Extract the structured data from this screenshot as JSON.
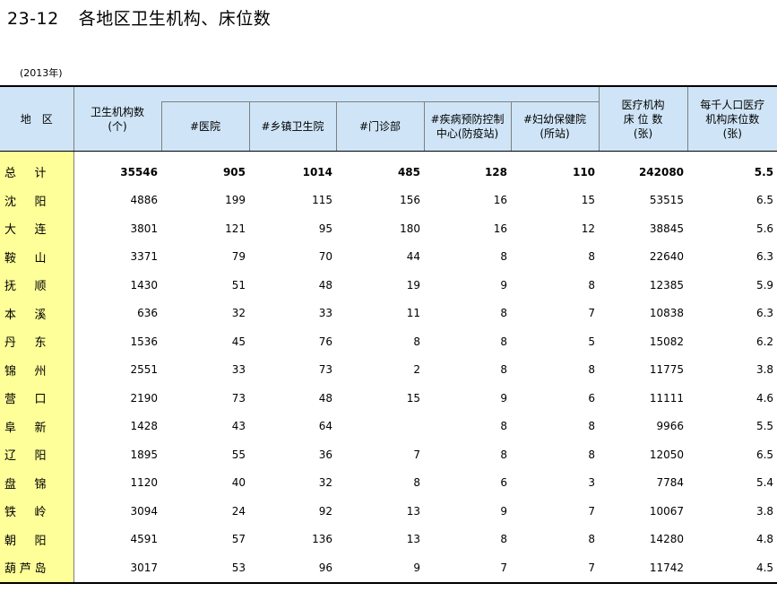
{
  "title": {
    "number": "23-12",
    "text": "各地区卫生机构、床位数"
  },
  "year_note": "(2013年)",
  "table": {
    "header_region": "地　区",
    "header_institutions": "卫生机构数",
    "header_institutions_unit": "(个)",
    "header_hospitals": "#医院",
    "header_township": "#乡镇卫生院",
    "header_clinics": "#门诊部",
    "header_cdc_line1": "#疾病预防控制",
    "header_cdc_line2": "中心(防疫站)",
    "header_mch_line1": "#妇幼保健院",
    "header_mch_line2": "(所站)",
    "header_beds_line1": "医疗机构",
    "header_beds_line2": "床 位 数",
    "header_beds_line3": "(张)",
    "header_per1000_line1": "每千人口医疗",
    "header_per1000_line2": "机构床位数",
    "header_per1000_line3": "(张)",
    "rows": [
      {
        "region": "总计",
        "inst": "35546",
        "hosp": "905",
        "town": "1014",
        "clinic": "485",
        "cdc": "128",
        "mch": "110",
        "beds": "242080",
        "per1000": "5.5"
      },
      {
        "region": "沈阳",
        "inst": "4886",
        "hosp": "199",
        "town": "115",
        "clinic": "156",
        "cdc": "16",
        "mch": "15",
        "beds": "53515",
        "per1000": "6.5"
      },
      {
        "region": "大连",
        "inst": "3801",
        "hosp": "121",
        "town": "95",
        "clinic": "180",
        "cdc": "16",
        "mch": "12",
        "beds": "38845",
        "per1000": "5.6"
      },
      {
        "region": "鞍山",
        "inst": "3371",
        "hosp": "79",
        "town": "70",
        "clinic": "44",
        "cdc": "8",
        "mch": "8",
        "beds": "22640",
        "per1000": "6.3"
      },
      {
        "region": "抚顺",
        "inst": "1430",
        "hosp": "51",
        "town": "48",
        "clinic": "19",
        "cdc": "9",
        "mch": "8",
        "beds": "12385",
        "per1000": "5.9"
      },
      {
        "region": "本溪",
        "inst": "636",
        "hosp": "32",
        "town": "33",
        "clinic": "11",
        "cdc": "8",
        "mch": "7",
        "beds": "10838",
        "per1000": "6.3"
      },
      {
        "region": "丹东",
        "inst": "1536",
        "hosp": "45",
        "town": "76",
        "clinic": "8",
        "cdc": "8",
        "mch": "5",
        "beds": "15082",
        "per1000": "6.2"
      },
      {
        "region": "锦州",
        "inst": "2551",
        "hosp": "33",
        "town": "73",
        "clinic": "2",
        "cdc": "8",
        "mch": "8",
        "beds": "11775",
        "per1000": "3.8"
      },
      {
        "region": "营口",
        "inst": "2190",
        "hosp": "73",
        "town": "48",
        "clinic": "15",
        "cdc": "9",
        "mch": "6",
        "beds": "11111",
        "per1000": "4.6"
      },
      {
        "region": "阜新",
        "inst": "1428",
        "hosp": "43",
        "town": "64",
        "clinic": "",
        "cdc": "8",
        "mch": "8",
        "beds": "9966",
        "per1000": "5.5"
      },
      {
        "region": "辽阳",
        "inst": "1895",
        "hosp": "55",
        "town": "36",
        "clinic": "7",
        "cdc": "8",
        "mch": "8",
        "beds": "12050",
        "per1000": "6.5"
      },
      {
        "region": "盘锦",
        "inst": "1120",
        "hosp": "40",
        "town": "32",
        "clinic": "8",
        "cdc": "6",
        "mch": "3",
        "beds": "7784",
        "per1000": "5.4"
      },
      {
        "region": "铁岭",
        "inst": "3094",
        "hosp": "24",
        "town": "92",
        "clinic": "13",
        "cdc": "9",
        "mch": "7",
        "beds": "10067",
        "per1000": "3.8"
      },
      {
        "region": "朝阳",
        "inst": "4591",
        "hosp": "57",
        "town": "136",
        "clinic": "13",
        "cdc": "8",
        "mch": "8",
        "beds": "14280",
        "per1000": "4.8"
      },
      {
        "region": "葫芦岛",
        "inst": "3017",
        "hosp": "53",
        "town": "96",
        "clinic": "9",
        "cdc": "7",
        "mch": "7",
        "beds": "11742",
        "per1000": "4.5"
      }
    ]
  }
}
